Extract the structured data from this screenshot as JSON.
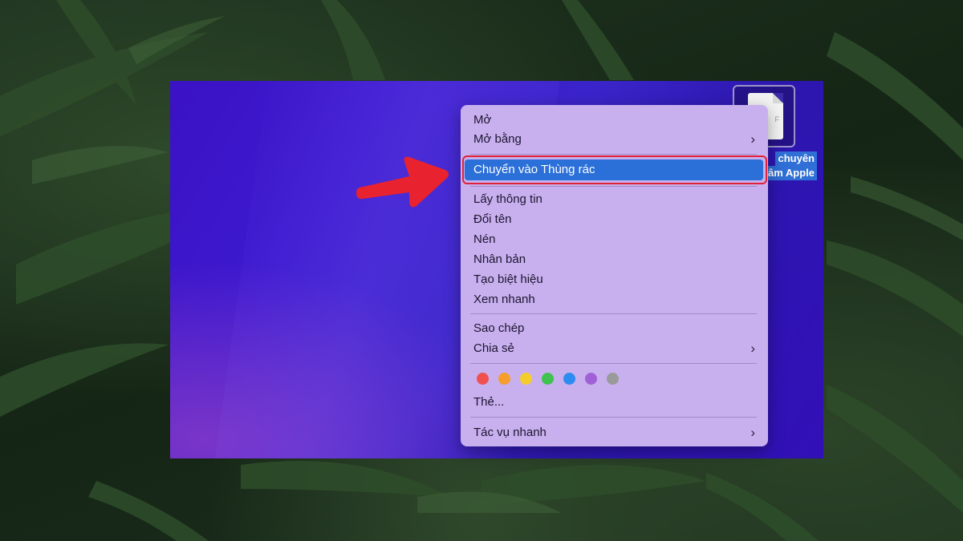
{
  "file": {
    "icon_name": "document-icon",
    "corner_text": "F",
    "label_lines": [
      "chuyên",
      "âm Apple"
    ]
  },
  "menu": {
    "items": {
      "open": "Mở",
      "open_with": "Mở bằng",
      "move_to_trash": "Chuyển vào Thùng rác",
      "get_info": "Lấy thông tin",
      "rename": "Đổi tên",
      "compress": "Nén",
      "duplicate": "Nhân bản",
      "make_alias": "Tạo biệt hiệu",
      "quick_look": "Xem nhanh",
      "copy": "Sao chép",
      "share": "Chia sẻ",
      "tags": "Thẻ...",
      "quick_actions": "Tác vụ nhanh"
    },
    "submenu_glyph": "›",
    "tag_colors": [
      "#f05050",
      "#f59e2b",
      "#f5cd2b",
      "#3fc24e",
      "#2e8cf0",
      "#a260d8",
      "#9a9a9a"
    ],
    "highlight_color": "#2b6fd8"
  },
  "annotation": {
    "arrow_color": "#e8222e",
    "box_color": "#e02238"
  }
}
